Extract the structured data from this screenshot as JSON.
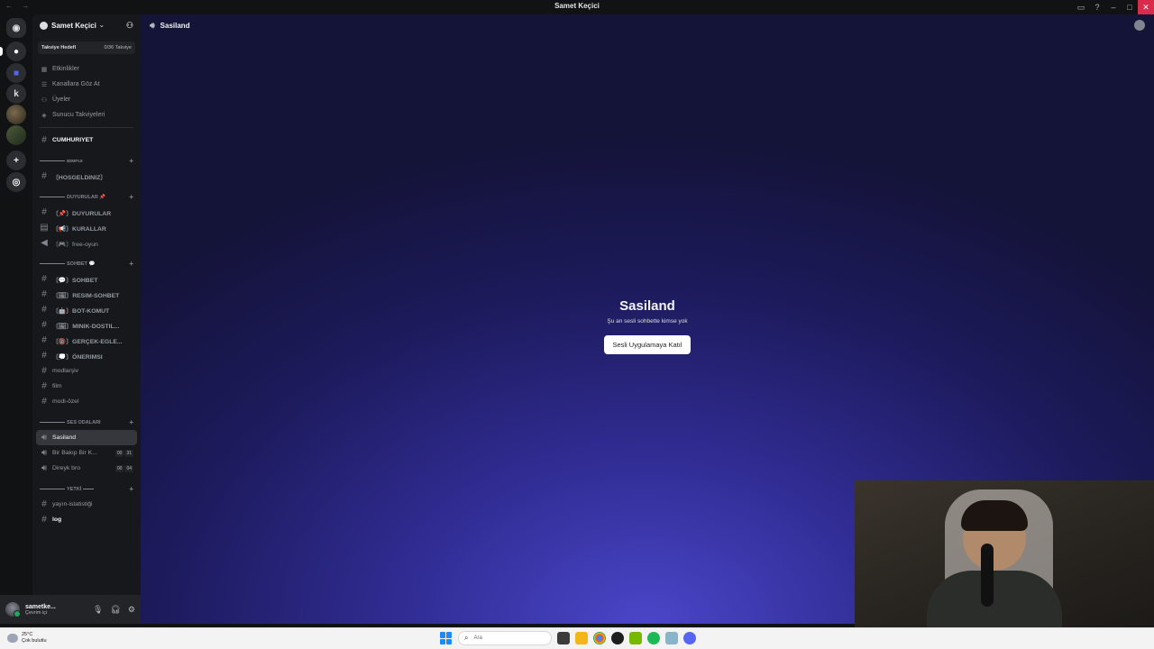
{
  "window": {
    "title": "Samet Keçici"
  },
  "server": {
    "name": "Samet Keçici",
    "boost_label": "Takviye Hedefi",
    "boost_progress": "0/36 Takviye"
  },
  "nav": [
    {
      "label": "Etkinlikler",
      "icon": "calendar-icon"
    },
    {
      "label": "Kanallara Göz At",
      "icon": "browse-icon"
    },
    {
      "label": "Üyeler",
      "icon": "members-icon"
    },
    {
      "label": "Sunucu Takviyeleri",
      "icon": "boost-icon"
    }
  ],
  "channels": {
    "cumhuriyet": "CUMHURIYET",
    "cat1": "ꜱɪᴍᴘʟᴇ",
    "hosgeldiniz": "〔HOSGELDINIZ〕",
    "cat2": "DUYURULAR 📌",
    "duyurular": "〔📌〕DUYURULAR",
    "kurallar": "〔📢〕KURALLAR",
    "free_oyun": "〔🎮〕free-oyun",
    "cat3": "SOHBET 💬",
    "sohbet": "〔💬〕SOHBET",
    "resim": "〔🖼〕RESIM-SOHBET",
    "bot": "〔🤖〕BOT-KOMUT",
    "minik": "〔🖼〕MINIK-DOSTIL...",
    "gercek": "〔🔞〕GERÇEK-EGLE...",
    "onerimsi": "〔💭〕ÖNERIMSI",
    "modlarsiv": "modlarşiv",
    "film": "film",
    "modi_ozel": "modi-özel",
    "cat4": "SES ODALARI",
    "sasiland": "Sasiland",
    "bir_bakip": "Bir Bakıp Bir K...",
    "bir_bakip_cnt": [
      "00",
      "31"
    ],
    "direyk": "Direyk bro",
    "direyk_cnt": [
      "00",
      "04"
    ],
    "cat5": "YETKİ",
    "yayin": "yayın-istatistiği",
    "log": "log"
  },
  "user": {
    "name": "sametke...",
    "status": "Çevrim içi"
  },
  "main": {
    "channel_name": "Sasiland",
    "voice_title": "Sasiland",
    "voice_subtitle": "Şu an sesli sohbette kimse yok",
    "join_button": "Sesli Uygulamaya Katıl"
  },
  "taskbar": {
    "temperature": "25°C",
    "weather": "Çok bulutlu",
    "search_placeholder": "Ara"
  },
  "colors": {
    "accent": "#5865f2",
    "online": "#23a55a",
    "close": "#d92b4b"
  }
}
